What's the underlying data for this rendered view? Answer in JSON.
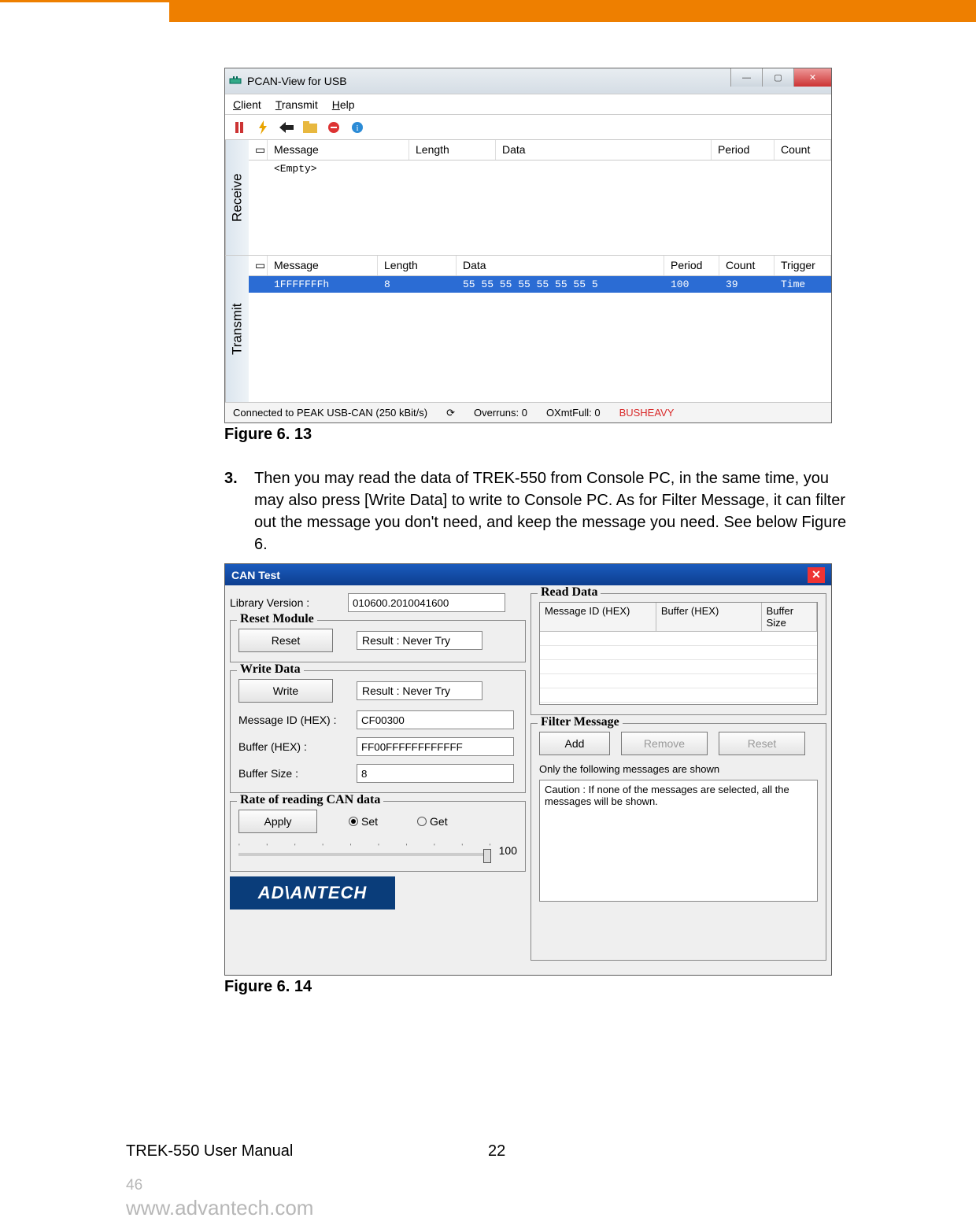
{
  "figures": {
    "fig13_caption": "Figure 6. 13",
    "fig14_caption": "Figure 6. 14"
  },
  "step": {
    "num": "3.",
    "text": "Then you may read the data of TREK-550 from Console PC, in the same time, you may also press [Write Data] to write to Console PC. As for Filter Message, it can filter out the message you don't need, and keep the message you need. See below Figure 6."
  },
  "footer": {
    "manual": "TREK-550 User Manual",
    "page_center": "22",
    "page_small": "46",
    "url": "www.advantech.com"
  },
  "pcan": {
    "title": "PCAN-View for USB",
    "menu": {
      "client": "Client",
      "transmit": "Transmit",
      "help": "Help"
    },
    "receive": {
      "label": "Receive",
      "columns": {
        "message": "Message",
        "length": "Length",
        "data": "Data",
        "period": "Period",
        "count": "Count"
      },
      "row": {
        "message": "<Empty>"
      }
    },
    "transmit": {
      "label": "Transmit",
      "columns": {
        "message": "Message",
        "length": "Length",
        "data": "Data",
        "period": "Period",
        "count": "Count",
        "trigger": "Trigger"
      },
      "row": {
        "message": "1FFFFFFFh",
        "length": "8",
        "data": "55 55 55 55 55 55 55 5",
        "period": "100",
        "count": "39",
        "trigger": "Time"
      }
    },
    "status": {
      "conn": "Connected to PEAK USB-CAN (250 kBit/s)",
      "overruns": "Overruns: 0",
      "oxmt": "OXmtFull: 0",
      "bus": "BUSHEAVY"
    }
  },
  "cantest": {
    "title": "CAN Test",
    "library_label": "Library Version :",
    "library_value": "010600.2010041600",
    "reset": {
      "title": "Reset Module",
      "btn": "Reset",
      "result": "Result : Never Try"
    },
    "write": {
      "title": "Write Data",
      "btn": "Write",
      "result": "Result : Never Try",
      "msg_id_label": "Message ID (HEX) :",
      "msg_id": "CF00300",
      "buf_label": "Buffer (HEX) :",
      "buf": "FF00FFFFFFFFFFFF",
      "size_label": "Buffer Size :",
      "size": "8"
    },
    "rate": {
      "title": "Rate of reading CAN data",
      "btn": "Apply",
      "opt_set": "Set",
      "opt_get": "Get",
      "value": "100"
    },
    "read": {
      "title": "Read Data",
      "cols": {
        "msg": "Message ID (HEX)",
        "buf": "Buffer (HEX)",
        "size": "Buffer Size"
      }
    },
    "filter": {
      "title": "Filter Message",
      "add": "Add",
      "remove": "Remove",
      "reset": "Reset",
      "note": "Only the following messages are shown",
      "caution": "Caution : If none of the messages are selected, all the messages will be shown."
    },
    "logo": "AD\\ANTECH"
  }
}
